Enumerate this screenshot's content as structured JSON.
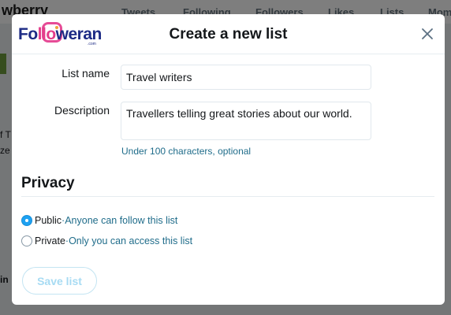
{
  "background": {
    "user_name": "wberry",
    "tabs": [
      "Tweets",
      "Following",
      "Followers",
      "Likes",
      "Lists",
      "Mom"
    ],
    "side_fragments": [
      "f T",
      "ze",
      "in"
    ]
  },
  "modal": {
    "logo": {
      "text_prefix": "Fo",
      "text_pink": "llo",
      "text_suffix": "weran",
      "small_text": ".com"
    },
    "title": "Create a new list",
    "close_icon": "close-icon",
    "list_name": {
      "label": "List name",
      "value": "Travel writers"
    },
    "description": {
      "label": "Description",
      "value": "Travellers telling great stories about our world.",
      "hint": "Under 100 characters, optional"
    },
    "privacy": {
      "title": "Privacy",
      "options": [
        {
          "label": "Public",
          "separator": " · ",
          "description": "Anyone can follow this list",
          "selected": true
        },
        {
          "label": "Private",
          "separator": " · ",
          "description": "Only you can access this list",
          "selected": false
        }
      ]
    },
    "save_label": "Save list"
  },
  "colors": {
    "accent": "#1da1f2",
    "hint_text": "#1f6c8a",
    "save_disabled_text": "#a7dbf3"
  }
}
